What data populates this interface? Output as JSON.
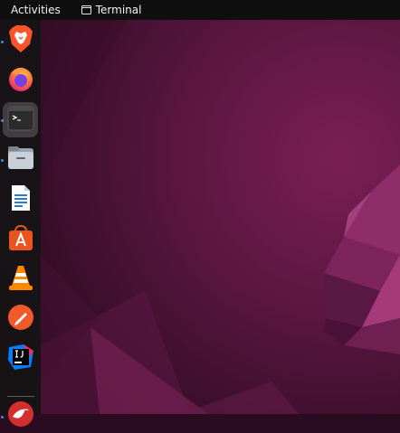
{
  "topbar": {
    "activities_label": "Activities",
    "app_label": "Terminal",
    "app_icon": "terminal-window-icon"
  },
  "dock": {
    "items": [
      {
        "name": "brave-browser",
        "icon": "brave-lion-icon",
        "running": true
      },
      {
        "name": "firefox",
        "icon": "firefox-icon",
        "running": false
      },
      {
        "name": "terminal",
        "icon": "terminal-icon",
        "running": true,
        "focused": true
      },
      {
        "name": "files",
        "icon": "files-folder-icon",
        "running": true
      },
      {
        "name": "libreoffice-writer",
        "icon": "writer-document-icon",
        "running": false
      },
      {
        "name": "ubuntu-software",
        "icon": "software-bag-icon",
        "running": false
      },
      {
        "name": "vlc",
        "icon": "vlc-cone-icon",
        "running": false
      },
      {
        "name": "text-editor",
        "icon": "pencil-icon",
        "running": false
      },
      {
        "name": "intellij-idea",
        "icon": "intellij-icon",
        "running": false
      },
      {
        "name": "app-red-bird",
        "icon": "red-bird-icon",
        "running": true
      }
    ]
  },
  "colors": {
    "topbar_bg": "#0f0f0f",
    "dock_bg": "#141414",
    "wallpaper_dark": "#2a0b1f",
    "wallpaper_mid": "#6b1a4a",
    "accent_running": "#3b8bd8"
  }
}
